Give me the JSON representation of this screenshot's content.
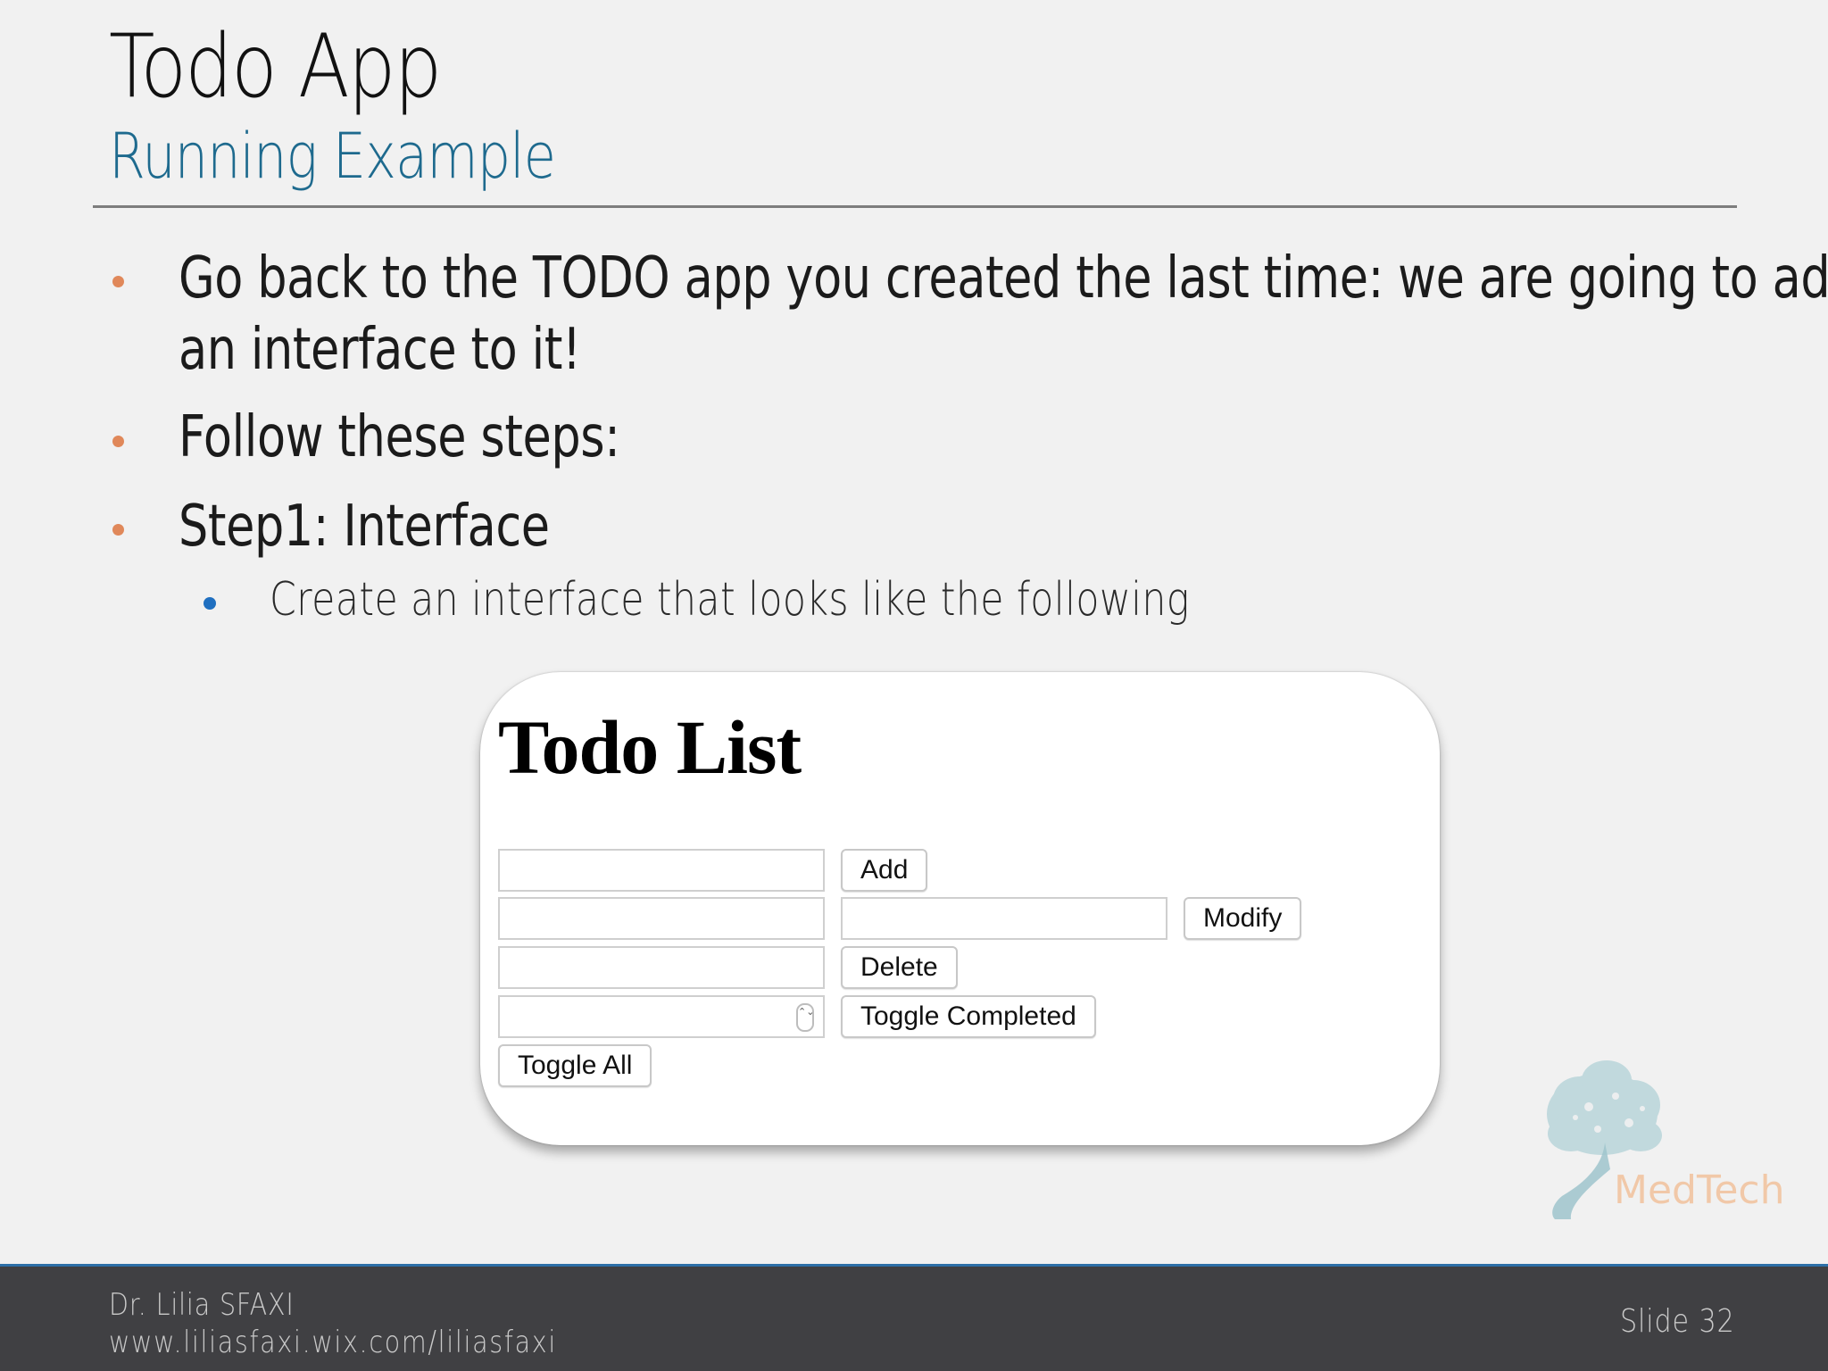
{
  "slide": {
    "title": "Todo App",
    "subtitle": "Running Example",
    "bullets": [
      "Go back to the TODO app you created the last time: we are going to add",
      "an interface to it!",
      "Follow these steps:",
      "Step1: Interface"
    ],
    "sub_bullet": "Create an interface that looks like the following"
  },
  "screenshot": {
    "heading": "Todo List",
    "buttons": {
      "add": "Add",
      "modify": "Modify",
      "delete": "Delete",
      "toggle_completed": "Toggle Completed",
      "toggle_all": "Toggle All"
    },
    "stepper_glyph": "⌃⌄"
  },
  "logo": {
    "text": "MedTech"
  },
  "footer": {
    "author": "Dr. Lilia SFAXI",
    "url": "www.liliasfaxi.wix.com/liliasfaxi",
    "slide_number": "Slide 32"
  },
  "colors": {
    "background": "#f1f1f1",
    "subtitle": "#1e6a8e",
    "bullet": "#e0885a",
    "sub_bullet": "#1f6fc0",
    "footer": "#404043",
    "footer_accent": "#2d6fa8",
    "logo_text": "#f1c8a8",
    "logo_tree": "#9fc4cc"
  }
}
